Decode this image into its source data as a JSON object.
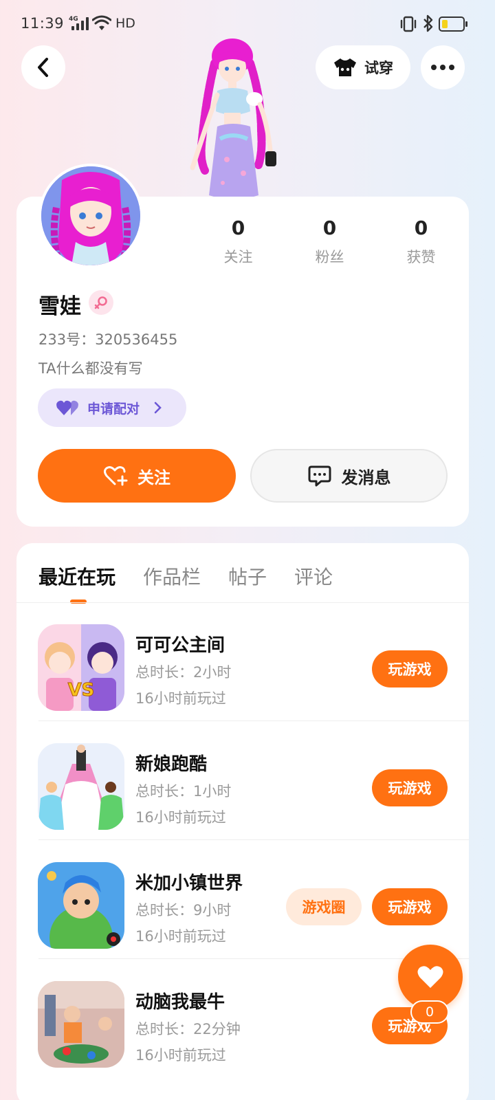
{
  "status_bar": {
    "time": "11:39",
    "network": "4G",
    "extra": "HD",
    "battery_color": "#f4d21b"
  },
  "header": {
    "back_icon": "chevron-left-icon",
    "tryon_label": "试穿",
    "more_icon": "more-horizontal-icon"
  },
  "profile": {
    "name": "雪娃",
    "gender_icon": "female-icon",
    "uid_label": "233号：",
    "uid": "320536455",
    "bio": "TA什么都没有写",
    "stats": [
      {
        "value": "0",
        "label": "关注"
      },
      {
        "value": "0",
        "label": "粉丝"
      },
      {
        "value": "0",
        "label": "获赞"
      }
    ],
    "pair_label": "申请配对",
    "follow_label": "关注",
    "message_label": "发消息"
  },
  "tabs": [
    {
      "label": "最近在玩",
      "active": true
    },
    {
      "label": "作品栏",
      "active": false
    },
    {
      "label": "帖子",
      "active": false
    },
    {
      "label": "评论",
      "active": false
    }
  ],
  "games": [
    {
      "title": "可可公主间",
      "time": "总时长：2小时",
      "last": "16小时前玩过",
      "play": "玩游戏",
      "circle": ""
    },
    {
      "title": "新娘跑酷",
      "time": "总时长：1小时",
      "last": "16小时前玩过",
      "play": "玩游戏",
      "circle": ""
    },
    {
      "title": "米加小镇世界",
      "time": "总时长：9小时",
      "last": "16小时前玩过",
      "play": "玩游戏",
      "circle": "游戏圈"
    },
    {
      "title": "动脑我最牛",
      "time": "总时长：22分钟",
      "last": "16小时前玩过",
      "play": "玩游戏",
      "circle": ""
    }
  ],
  "like_fab": {
    "count": "0"
  },
  "colors": {
    "accent": "#ff7112",
    "pair": "#6c57d6"
  }
}
